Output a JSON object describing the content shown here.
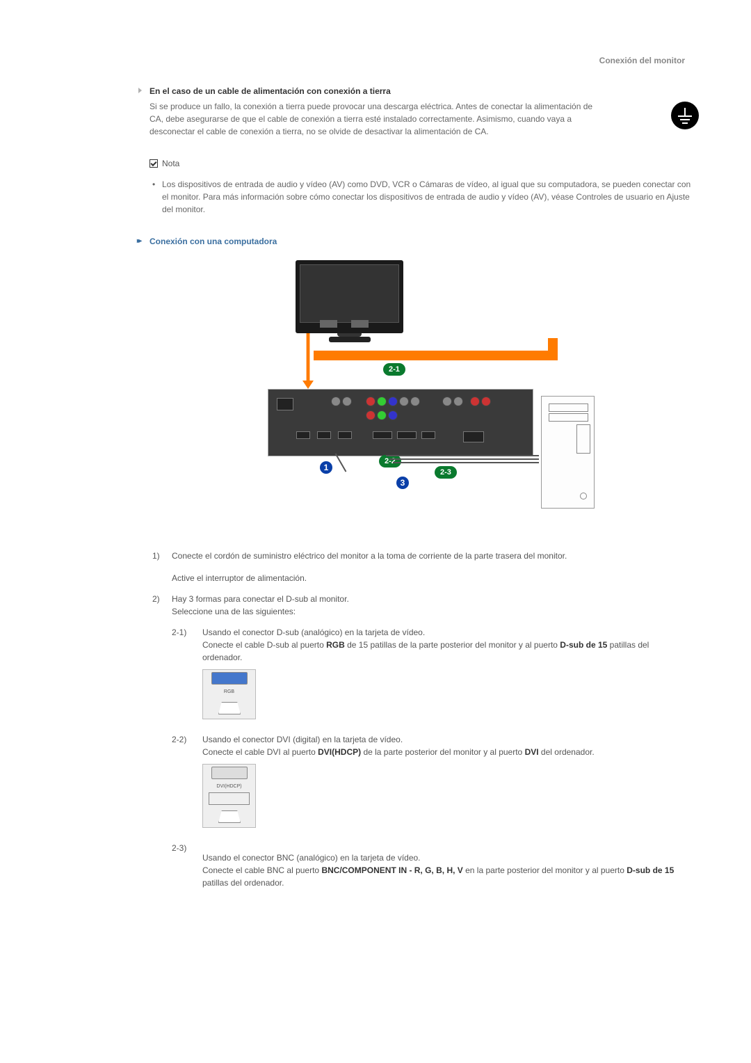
{
  "header": {
    "title_right": "Conexión del monitor"
  },
  "section_ground": {
    "title": "En el caso de un cable de alimentación con conexión a tierra",
    "body": "Si se produce un fallo, la conexión a tierra puede provocar una descarga eléctrica. Antes de conectar la alimentación de CA, debe asegurarse de que el cable de conexión a tierra esté instalado correctamente. Asimismo, cuando vaya a desconectar el cable de conexión a tierra, no se olvide de desactivar la alimentación de CA."
  },
  "nota_label": "Nota",
  "nota_bullet": "Los dispositivos de entrada de audio y vídeo (AV) como DVD, VCR o Cámaras de vídeo, al igual que su computadora, se pueden conectar con el monitor. Para más información sobre cómo conectar los dispositivos de entrada de audio y vídeo (AV), véase Controles de usuario en Ajuste del monitor.",
  "subheading": "Conexión con una computadora",
  "diagram": {
    "tag_21": "2-1",
    "tag_22": "2-2",
    "tag_23": "2-3",
    "circle_1": "1",
    "circle_3": "3"
  },
  "steps": {
    "n1": "1)",
    "s1_a": "Conecte el cordón de suministro eléctrico del monitor a la toma de corriente de la parte trasera del monitor.",
    "s1_b": "Active el interruptor de alimentación.",
    "n2": "2)",
    "s2_intro_a": "Hay 3 formas para conectar el D-sub al monitor.",
    "s2_intro_b": "Seleccione una de las siguientes:",
    "n21": "2-1)",
    "s21_a": "Usando el conector D-sub (analógico) en la tarjeta de vídeo.",
    "s21_b_pre": "Conecte el cable D-sub al puerto ",
    "s21_b_bold1": "RGB",
    "s21_b_mid": " de 15 patillas de la parte posterior del monitor y al puerto ",
    "s21_b_bold2": "D-sub de 15",
    "s21_b_post": " patillas del ordenador.",
    "rgb_label": "RGB",
    "n22": "2-2)",
    "s22_a": "Usando el conector DVI (digital) en la tarjeta de vídeo.",
    "s22_b_pre": "Conecte el cable DVI al puerto ",
    "s22_b_bold1": "DVI(HDCP)",
    "s22_b_mid": " de la parte posterior del monitor y al puerto ",
    "s22_b_bold2": "DVI",
    "s22_b_post": " del ordenador.",
    "dvi_label": "DVI(HDCP)",
    "n23": "2-3)",
    "s23_a": "Usando el conector BNC (analógico) en la tarjeta de vídeo.",
    "s23_b_pre": "Conecte el cable BNC al puerto ",
    "s23_b_bold1": "BNC/COMPONENT IN - R, G, B, H, V",
    "s23_b_mid": " en la parte posterior del monitor y al puerto ",
    "s23_b_bold2": "D-sub de 15",
    "s23_b_post": " patillas del ordenador."
  }
}
